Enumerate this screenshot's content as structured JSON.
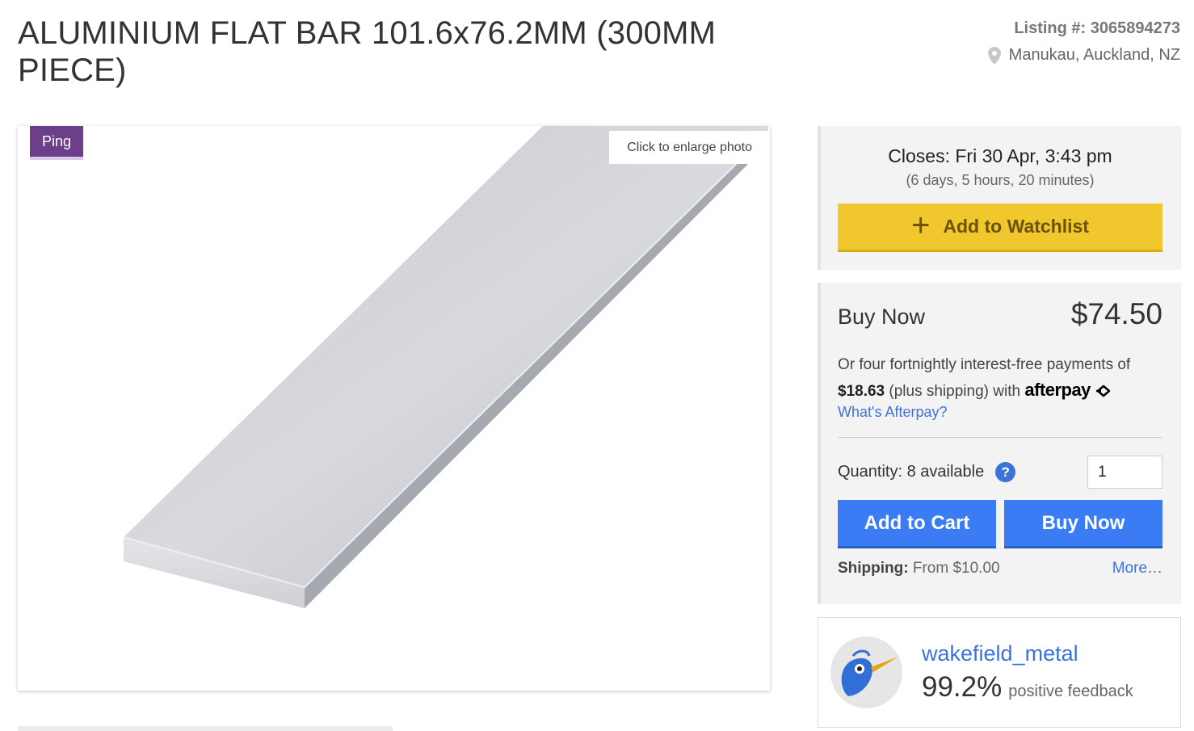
{
  "listing": {
    "title": "ALUMINIUM FLAT BAR 101.6x76.2MM (300MM PIECE)",
    "listing_number": "Listing #: 3065894273",
    "location": "Manukau, Auckland, NZ"
  },
  "photo": {
    "badge": "Ping",
    "enlarge_label": "Click to enlarge photo"
  },
  "auction": {
    "closes": "Closes: Fri 30 Apr, 3:43 pm",
    "remaining": "(6 days, 5 hours, 20 minutes)",
    "watchlist_label": "Add to Watchlist"
  },
  "buy": {
    "label": "Buy Now",
    "price": "$74.50",
    "afterpay_prefix": "Or four fortnightly interest-free payments of",
    "afterpay_amount": "$18.63",
    "afterpay_suffix": "(plus shipping) with",
    "afterpay_brand": "afterpay",
    "afterpay_link": "What's Afterpay?",
    "quantity_label": "Quantity: 8 available",
    "quantity_value": "1",
    "add_to_cart": "Add to Cart",
    "buy_now_button": "Buy Now",
    "shipping_label": "Shipping:",
    "shipping_value": "From $10.00",
    "more_link": "More…"
  },
  "seller": {
    "name": "wakefield_metal",
    "feedback_pct": "99.2%",
    "feedback_text": "positive feedback"
  },
  "colors": {
    "watchlist": "#f0c72c",
    "primary_button": "#3b7cf5",
    "link": "#3b73d9",
    "badge": "#6b3f8a"
  }
}
